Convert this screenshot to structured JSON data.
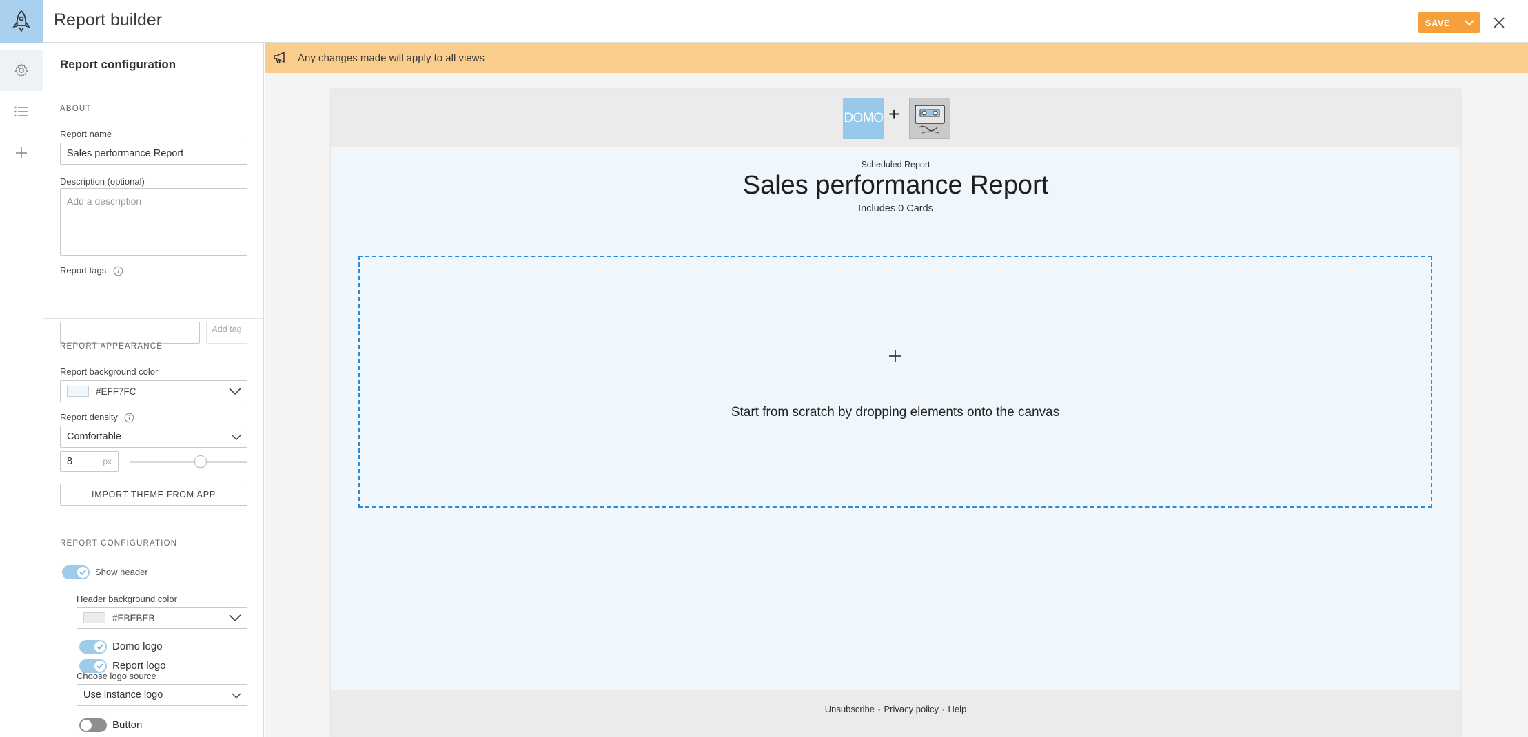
{
  "header": {
    "title": "Report builder",
    "save_label": "SAVE",
    "accent": "#F5A03A"
  },
  "rail": {
    "items": [
      {
        "icon": "gear-icon",
        "active": true
      },
      {
        "icon": "list-icon",
        "active": false
      },
      {
        "icon": "plus-icon",
        "active": false
      }
    ]
  },
  "config": {
    "title": "Report configuration",
    "about": {
      "section_title": "ABOUT",
      "name_label": "Report name",
      "name_value": "Sales performance Report",
      "description_label": "Description (optional)",
      "description_placeholder": "Add a description",
      "tags_label": "Report tags",
      "add_tag_label": "Add tag"
    },
    "appearance": {
      "section_title": "REPORT APPEARANCE",
      "bg_color_label": "Report background color",
      "bg_color_value": "#EFF7FC",
      "density_label": "Report density",
      "density_value": "Comfortable",
      "spacing_value": "8",
      "spacing_unit": "px",
      "spacing_slider_fraction": 0.6,
      "import_theme_label": "IMPORT THEME FROM APP"
    },
    "configuration": {
      "section_title": "REPORT CONFIGURATION",
      "show_header_label": "Show header",
      "show_header_on": true,
      "header_bg_label": "Header background color",
      "header_bg_value": "#EBEBEB",
      "domo_logo_label": "Domo logo",
      "domo_logo_on": true,
      "report_logo_label": "Report logo",
      "report_logo_on": true,
      "logo_source_label": "Choose logo source",
      "logo_source_value": "Use instance logo",
      "button_label": "Button",
      "button_on": false
    }
  },
  "banner": {
    "text": "Any changes made will apply to all views",
    "color": "#FBCD8C"
  },
  "report": {
    "domo_logo_text": "DOMO",
    "plus": "+",
    "scheduled_label": "Scheduled Report",
    "title": "Sales performance Report",
    "cards_count": "Includes 0 Cards",
    "dropzone_text": "Start from scratch by dropping elements onto the canvas",
    "footer": {
      "unsubscribe": "Unsubscribe",
      "privacy": "Privacy policy",
      "help": "Help",
      "separator": "•"
    }
  }
}
